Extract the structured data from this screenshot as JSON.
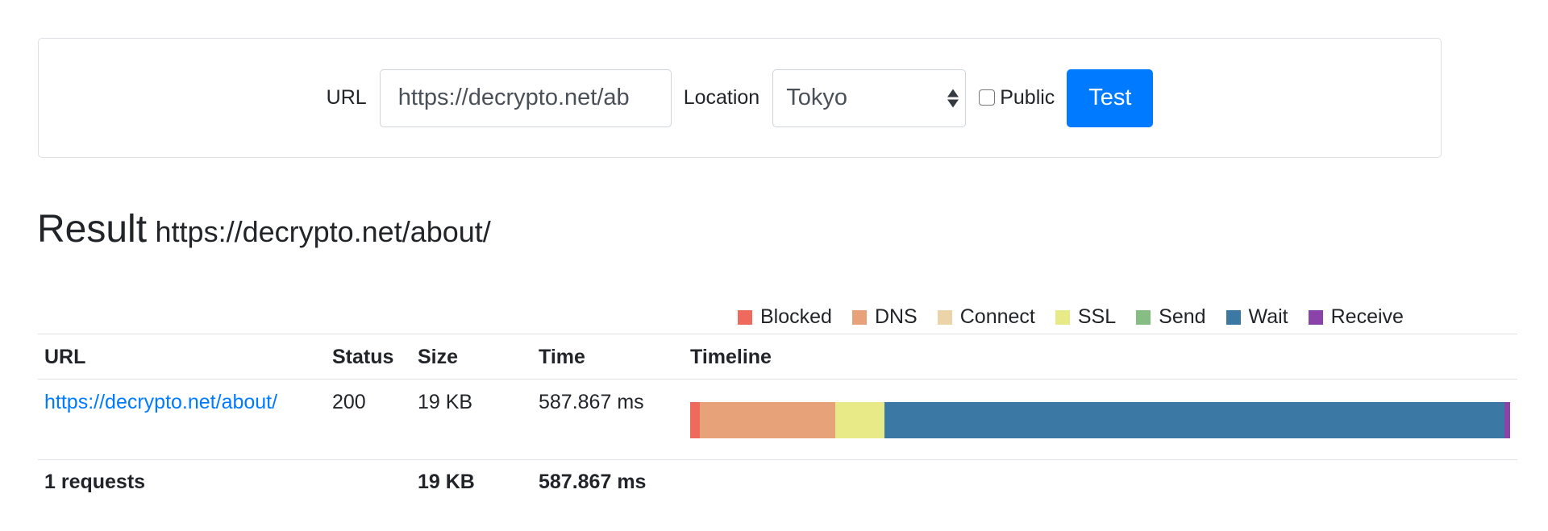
{
  "form": {
    "url_label": "URL",
    "url_value": "https://decrypto.net/ab",
    "location_label": "Location",
    "location_value": "Tokyo",
    "public_label": "Public",
    "public_checked": false,
    "test_label": "Test"
  },
  "result": {
    "heading": "Result",
    "url": "https://decrypto.net/about/"
  },
  "legend": [
    {
      "label": "Blocked",
      "color": "#ee6a5c"
    },
    {
      "label": "DNS",
      "color": "#e7a27a"
    },
    {
      "label": "Connect",
      "color": "#ecd3a8"
    },
    {
      "label": "SSL",
      "color": "#e8ea87"
    },
    {
      "label": "Send",
      "color": "#86bd83"
    },
    {
      "label": "Wait",
      "color": "#3b78a4"
    },
    {
      "label": "Receive",
      "color": "#8a43a8"
    }
  ],
  "table": {
    "headers": {
      "url": "URL",
      "status": "Status",
      "size": "Size",
      "time": "Time",
      "timeline": "Timeline"
    },
    "rows": [
      {
        "url": "https://decrypto.net/about/",
        "status": "200",
        "size": "19 KB",
        "time": "587.867 ms",
        "timeline_fractions": {
          "blocked": 0.012,
          "dns": 0.165,
          "connect": 0.0,
          "ssl": 0.06,
          "send": 0.0,
          "wait": 0.756,
          "receive": 0.007
        }
      }
    ],
    "footer": {
      "requests": "1 requests",
      "size": "19 KB",
      "time": "587.867 ms"
    }
  },
  "colors": {
    "primary": "#007bff",
    "link": "#007bff",
    "border": "#dee2e6"
  }
}
